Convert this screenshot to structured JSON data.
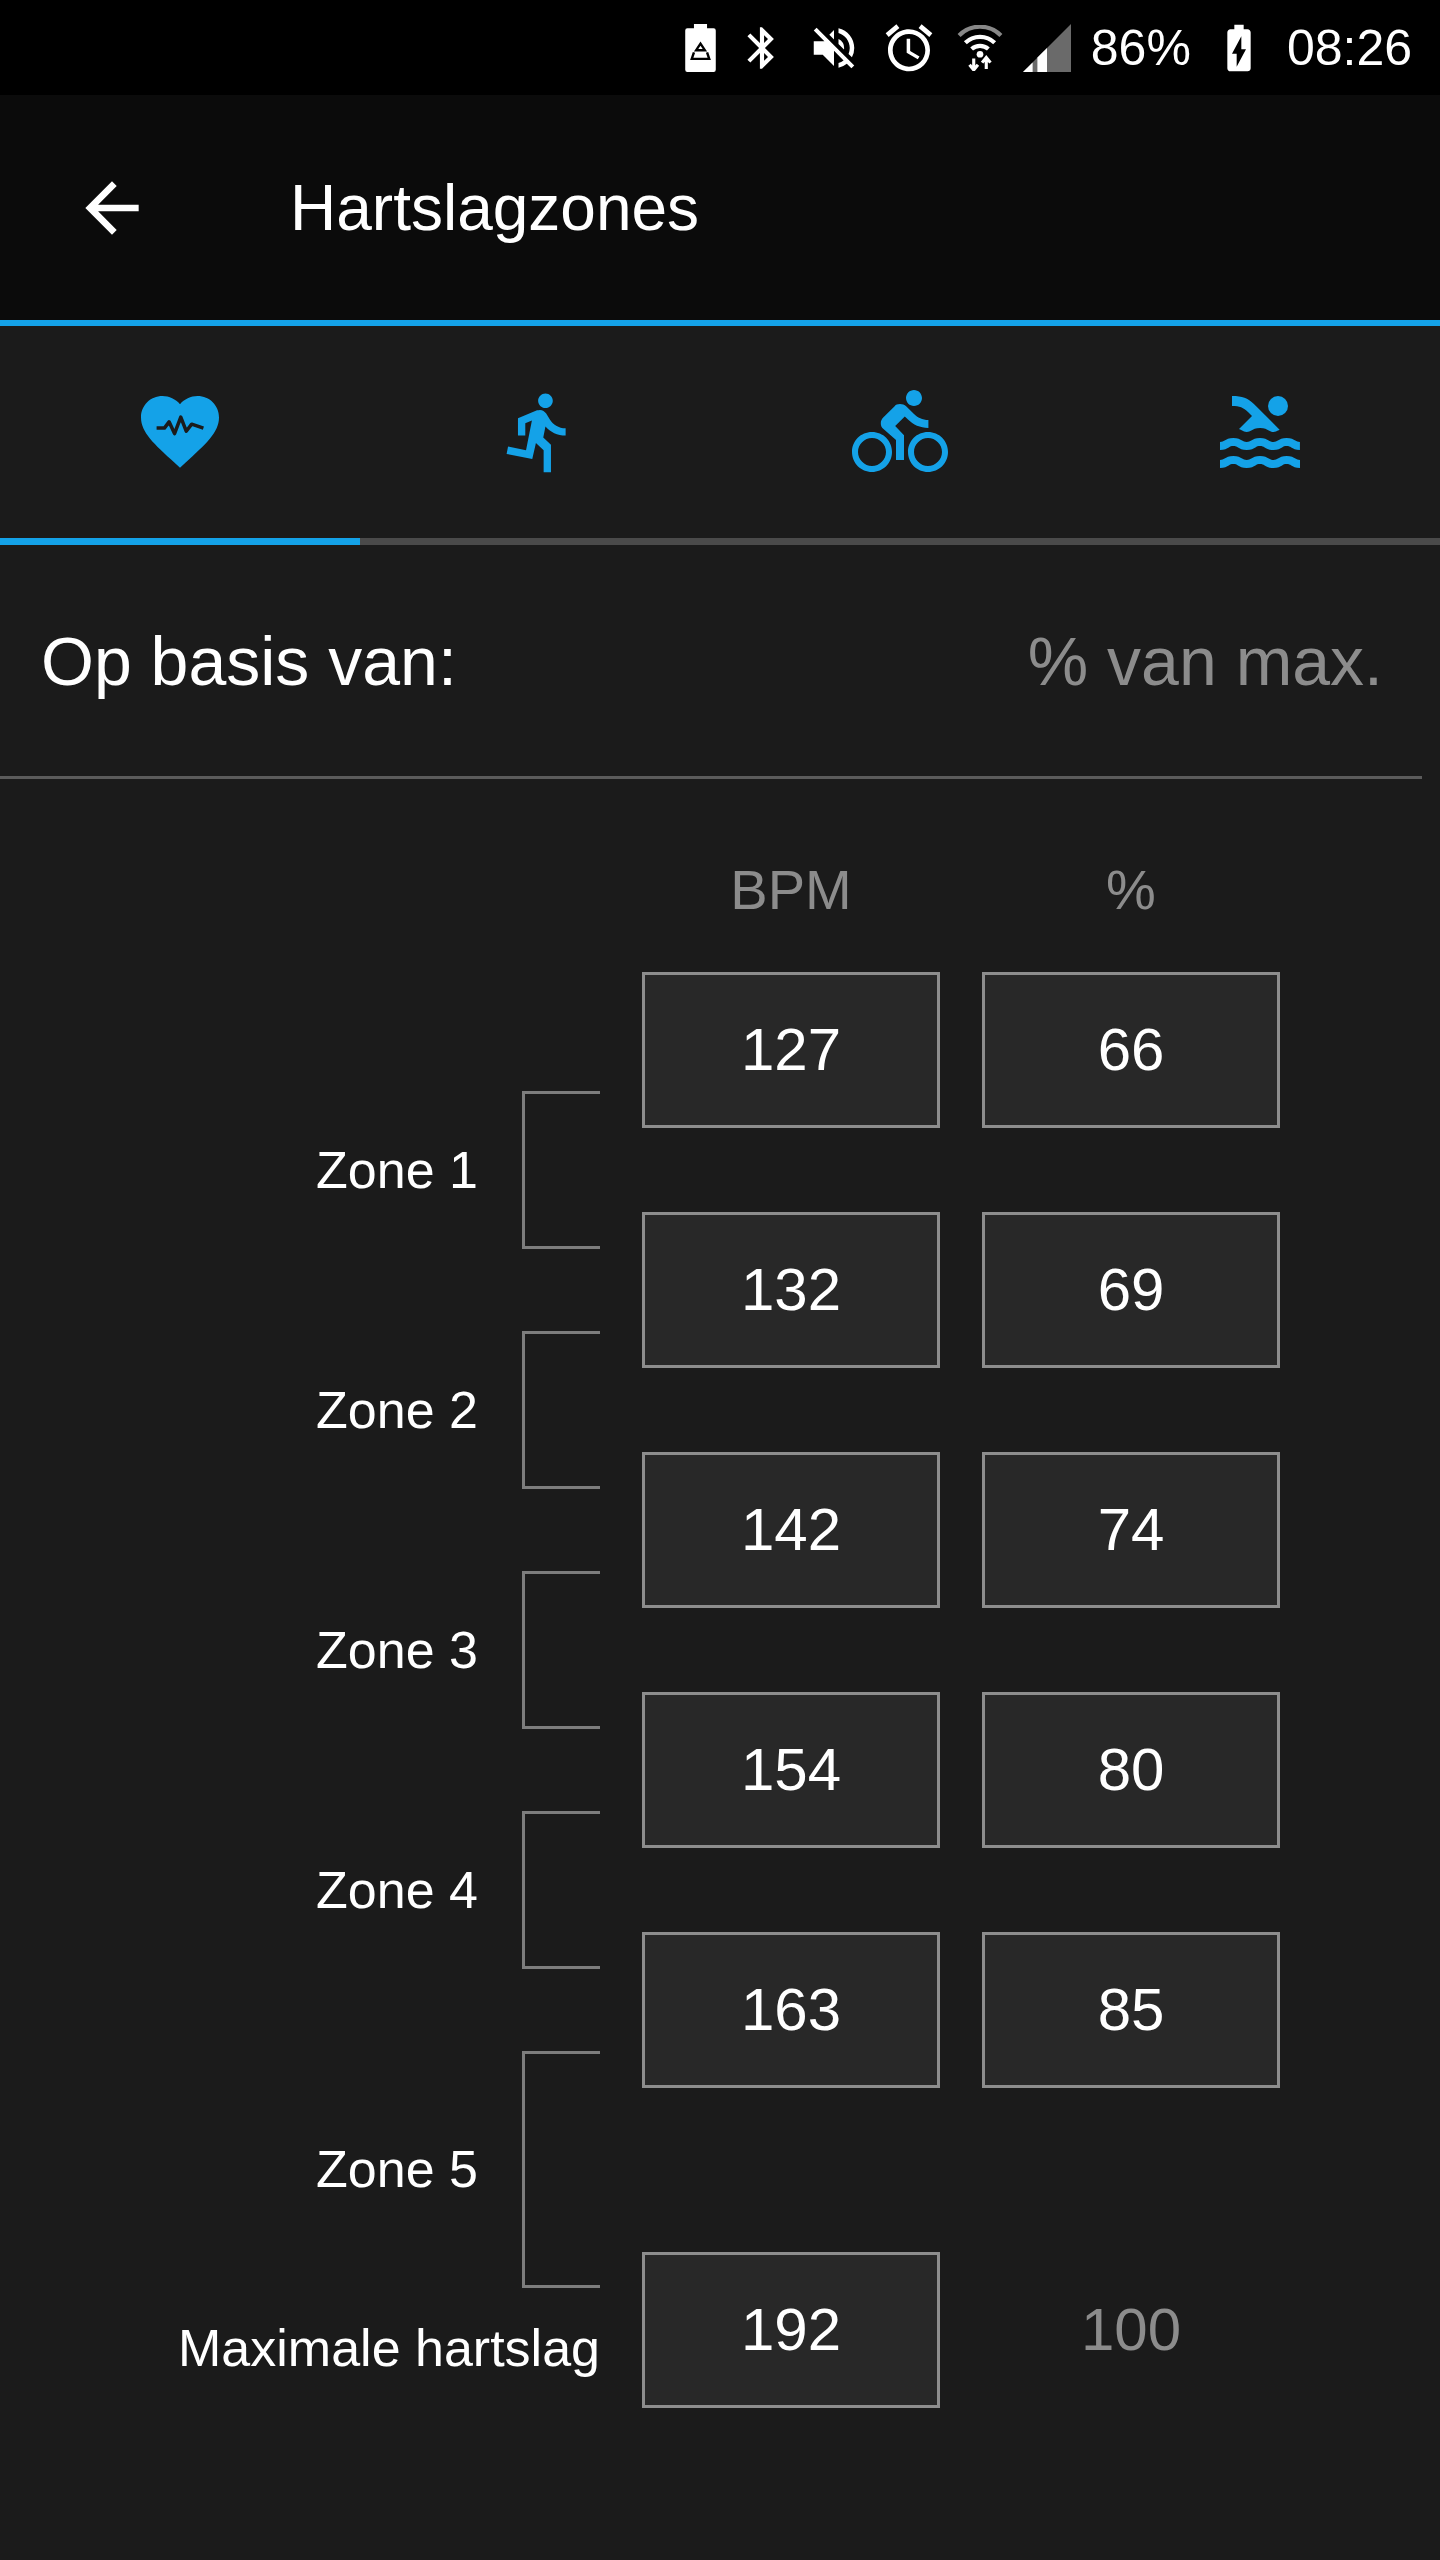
{
  "status_bar": {
    "battery": "86%",
    "time": "08:26"
  },
  "header": {
    "title": "Hartslagzones"
  },
  "tabs": [
    {
      "kind": "heart",
      "selected": true
    },
    {
      "kind": "running",
      "selected": false
    },
    {
      "kind": "cycling",
      "selected": false
    },
    {
      "kind": "swimming",
      "selected": false
    }
  ],
  "basis": {
    "label": "Op basis van:",
    "value": "% van max."
  },
  "zones_table": {
    "columns": [
      "BPM",
      "%"
    ],
    "boundaries": [
      {
        "bpm": "127",
        "percent": "66"
      },
      {
        "bpm": "132",
        "percent": "69"
      },
      {
        "bpm": "142",
        "percent": "74"
      },
      {
        "bpm": "154",
        "percent": "80"
      },
      {
        "bpm": "163",
        "percent": "85"
      }
    ],
    "zones": [
      "Zone 1",
      "Zone 2",
      "Zone 3",
      "Zone 4",
      "Zone 5"
    ],
    "max": {
      "label": "Maximale hartslag",
      "bpm": "192",
      "percent": "100"
    }
  }
}
